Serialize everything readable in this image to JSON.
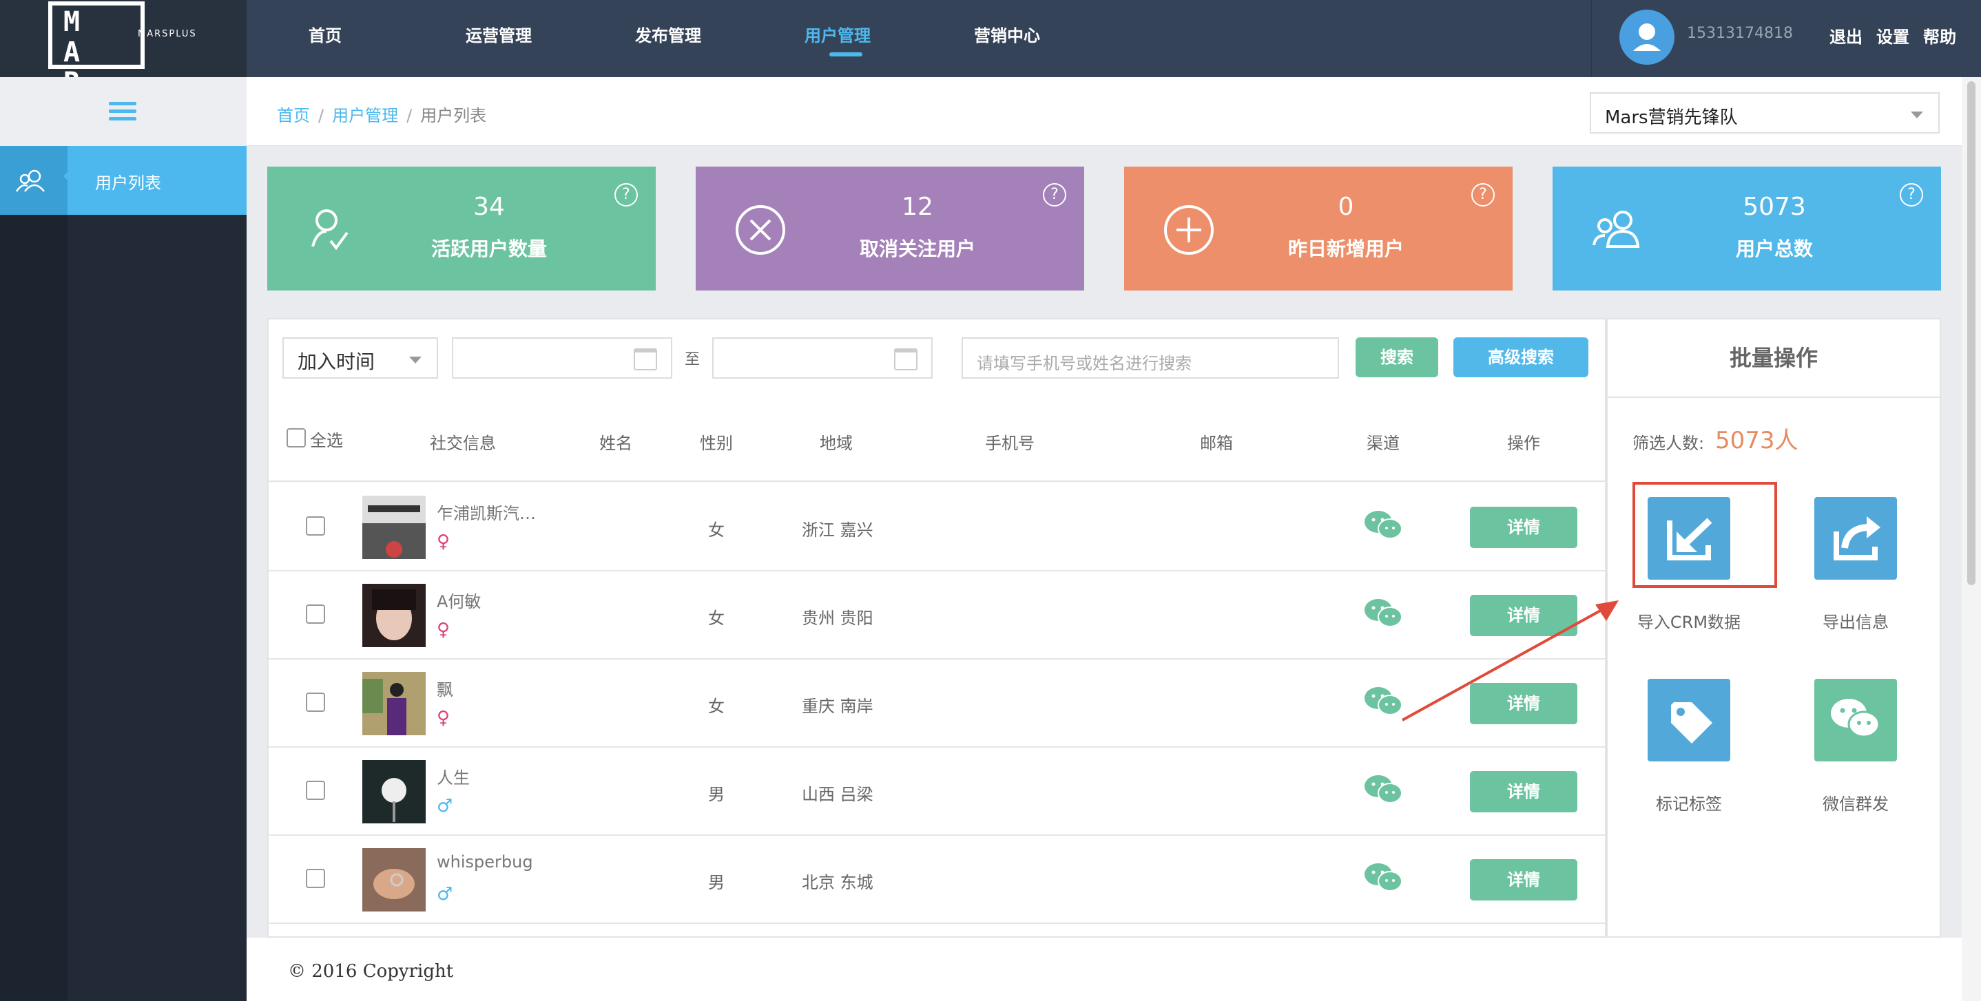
{
  "brand": {
    "logo_letters": "M A R S",
    "logo_sub": "MARSPLUS"
  },
  "nav": {
    "items": [
      {
        "label": "首页"
      },
      {
        "label": "运营管理"
      },
      {
        "label": "发布管理"
      },
      {
        "label": "用户管理",
        "active": true
      },
      {
        "label": "营销中心"
      }
    ]
  },
  "user": {
    "phone": "15313174818",
    "logout": "退出",
    "settings": "设置",
    "help": "帮助"
  },
  "sidebar": {
    "items": [
      {
        "label": "用户列表",
        "icon": "users-icon",
        "active": true
      }
    ]
  },
  "breadcrumb": {
    "home": "首页",
    "section": "用户管理",
    "current": "用户列表"
  },
  "team_select": {
    "value": "Mars营销先锋队"
  },
  "stats": [
    {
      "value": "34",
      "label": "活跃用户数量",
      "icon": "active-user-icon",
      "color": "#6cc3a0"
    },
    {
      "value": "12",
      "label": "取消关注用户",
      "icon": "cancel-icon",
      "color": "#a481b8"
    },
    {
      "value": "0",
      "label": "昨日新增用户",
      "icon": "plus-circle-icon",
      "color": "#ec8f6a"
    },
    {
      "value": "5073",
      "label": "用户总数",
      "icon": "users-icon",
      "color": "#52b8ea"
    }
  ],
  "filters": {
    "time_select": "加入时间",
    "to_label": "至",
    "search_placeholder": "请填写手机号或姓名进行搜索",
    "search_btn": "搜索",
    "advanced_btn": "高级搜索"
  },
  "table": {
    "select_all": "全选",
    "columns": [
      "社交信息",
      "姓名",
      "性别",
      "地域",
      "手机号",
      "邮箱",
      "渠道",
      "操作"
    ],
    "rows": [
      {
        "nick": "乍浦凯斯汽…",
        "gender": "女",
        "gender_icon": "female-icon",
        "region": "浙江 嘉兴",
        "channel_icon": "wechat-icon",
        "action": "详情"
      },
      {
        "nick": "A何敏",
        "gender": "女",
        "gender_icon": "female-icon",
        "region": "贵州 贵阳",
        "channel_icon": "wechat-icon",
        "action": "详情"
      },
      {
        "nick": "飘",
        "gender": "女",
        "gender_icon": "female-icon",
        "region": "重庆 南岸",
        "channel_icon": "wechat-icon",
        "action": "详情"
      },
      {
        "nick": "人生",
        "gender": "男",
        "gender_icon": "male-icon",
        "region": "山西 吕梁",
        "channel_icon": "wechat-icon",
        "action": "详情"
      },
      {
        "nick": "whisperbug",
        "gender": "男",
        "gender_icon": "male-icon",
        "region": "北京 东城",
        "channel_icon": "wechat-icon",
        "action": "详情"
      }
    ]
  },
  "batch": {
    "title": "批量操作",
    "count_label": "筛选人数:",
    "count_value": "5073人",
    "actions": [
      {
        "label": "导入CRM数据",
        "icon": "import-icon"
      },
      {
        "label": "导出信息",
        "icon": "export-icon"
      },
      {
        "label": "标记标签",
        "icon": "tag-icon"
      },
      {
        "label": "微信群发",
        "icon": "wechat-icon"
      }
    ]
  },
  "footer": {
    "copyright": "© 2016 Copyright"
  },
  "colors": {
    "topbar": "#354358",
    "accent": "#4db8ee",
    "green": "#6cc3a0",
    "highlight": "#e04a3a"
  }
}
